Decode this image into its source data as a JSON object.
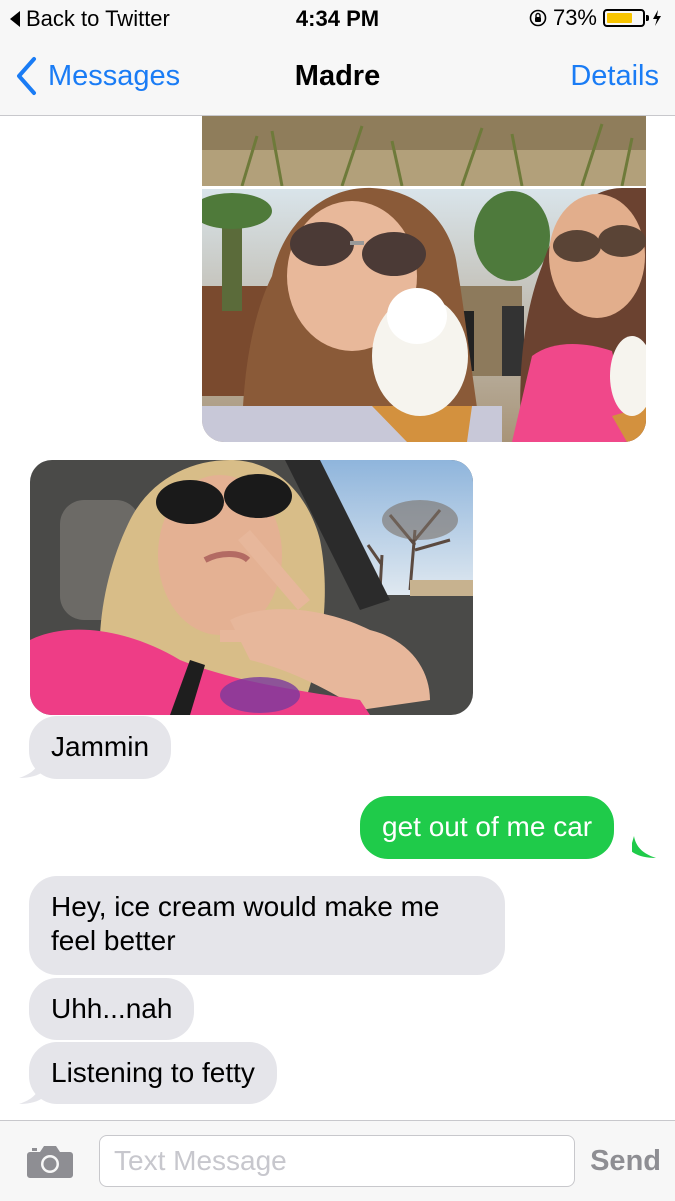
{
  "status_bar": {
    "back_app": "Back to Twitter",
    "time": "4:34 PM",
    "battery_percent": "73%",
    "battery_level": 0.73
  },
  "nav": {
    "back_label": "Messages",
    "title": "Madre",
    "details_label": "Details"
  },
  "messages": [
    {
      "from": "me",
      "kind": "photo"
    },
    {
      "from": "them",
      "kind": "photo"
    },
    {
      "from": "them",
      "kind": "text",
      "text": "Jammin"
    },
    {
      "from": "me",
      "kind": "text",
      "text": "get out of me car"
    },
    {
      "from": "them",
      "kind": "text",
      "text": "Hey, ice cream would make me feel better"
    },
    {
      "from": "them",
      "kind": "text",
      "text": "Uhh...nah"
    },
    {
      "from": "them",
      "kind": "text",
      "text": "Listening to fetty"
    }
  ],
  "input": {
    "placeholder": "Text Message",
    "value": "",
    "send_label": "Send"
  },
  "colors": {
    "accent": "#1a7cf5",
    "sent_bubble": "#1fcb4a",
    "received_bubble": "#e5e5ea",
    "battery_fill": "#f7c400"
  },
  "icons": [
    "back-triangle-icon",
    "orientation-lock-icon",
    "battery-icon",
    "charging-bolt-icon",
    "chevron-left-icon",
    "camera-icon"
  ]
}
